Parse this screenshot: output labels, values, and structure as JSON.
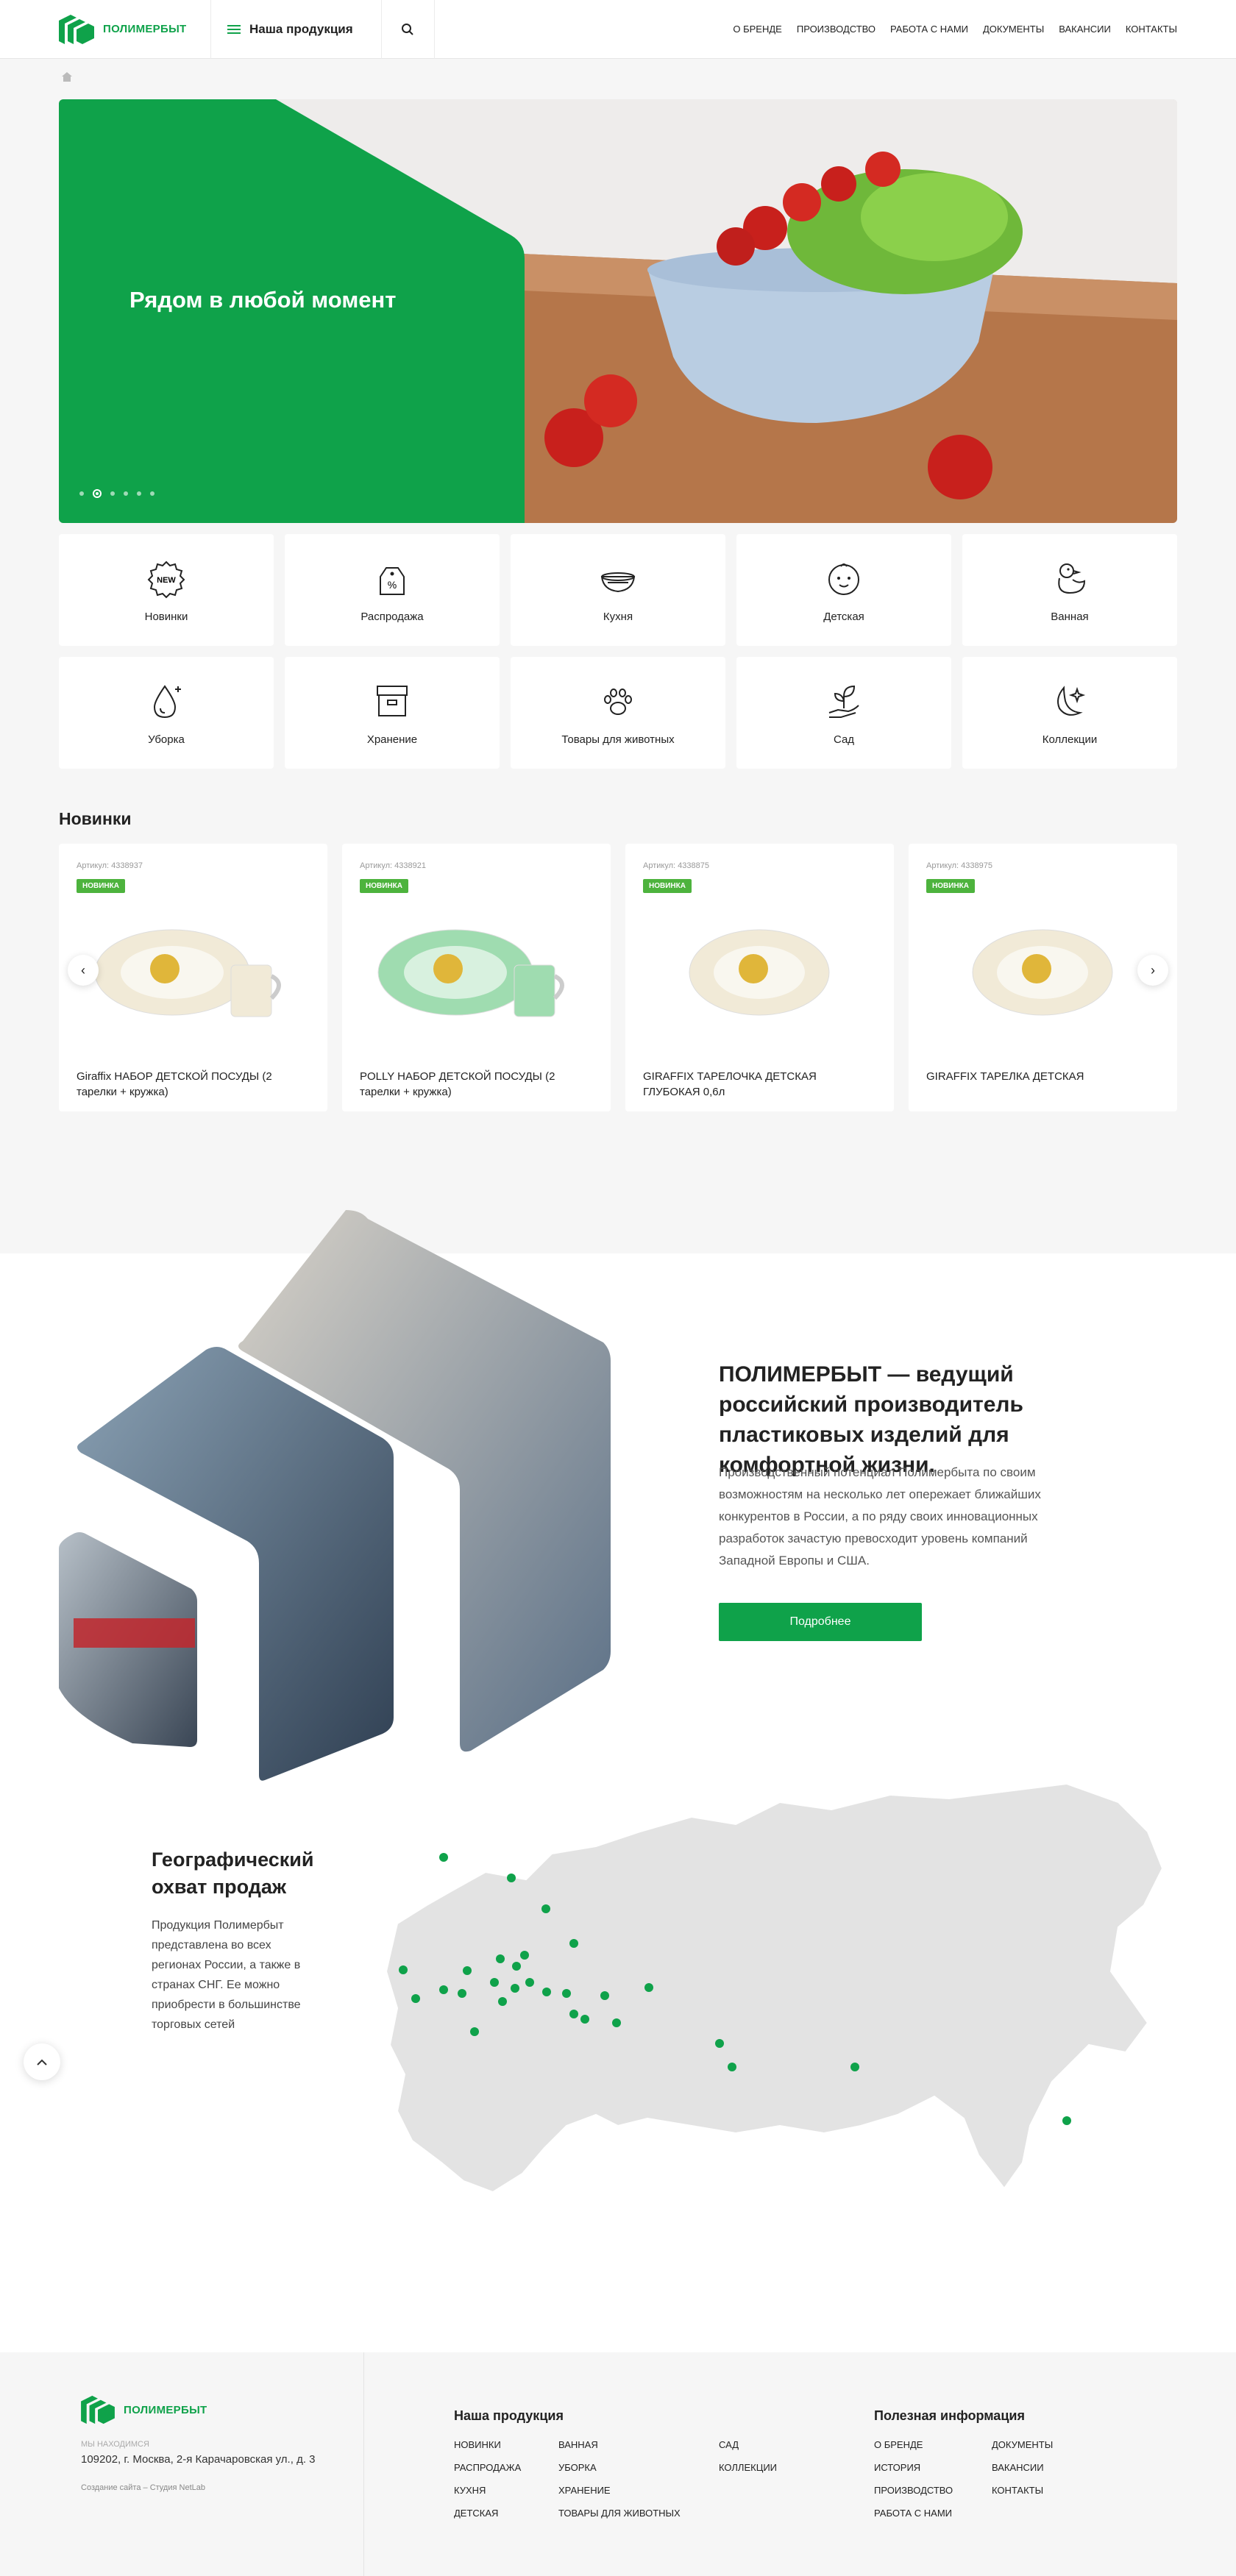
{
  "brand": {
    "name": "ПОЛИМЕРБЫТ",
    "color": "#0fa24a"
  },
  "header": {
    "products_label": "Наша продукция",
    "nav": [
      "О БРЕНДЕ",
      "ПРОИЗВОДСТВО",
      "РАБОТА С НАМИ",
      "ДОКУМЕНТЫ",
      "ВАКАНСИИ",
      "КОНТАКТЫ"
    ]
  },
  "hero": {
    "title": "Рядом в любой момент",
    "slides": 6,
    "active_slide": 2
  },
  "categories": [
    {
      "label": "Новинки",
      "icon": "new-badge-icon"
    },
    {
      "label": "Распродажа",
      "icon": "sale-tag-icon"
    },
    {
      "label": "Кухня",
      "icon": "bowl-icon"
    },
    {
      "label": "Детская",
      "icon": "baby-face-icon"
    },
    {
      "label": "Ванная",
      "icon": "rubber-duck-icon"
    },
    {
      "label": "Уборка",
      "icon": "water-drop-icon"
    },
    {
      "label": "Хранение",
      "icon": "storage-box-icon"
    },
    {
      "label": "Товары для животных",
      "icon": "paw-icon"
    },
    {
      "label": "Сад",
      "icon": "plant-hand-icon"
    },
    {
      "label": "Коллекции",
      "icon": "moon-icon"
    }
  ],
  "novinki": {
    "title": "Новинки",
    "badge": "НОВИНКА",
    "products": [
      {
        "sku": "Артикул: 4338937",
        "name": "Giraffix НАБОР ДЕТСКОЙ ПОСУДЫ (2 тарелки + кружка)",
        "tint": "#f1ead7"
      },
      {
        "sku": "Артикул: 4338921",
        "name": "POLLY НАБОР ДЕТСКОЙ ПОСУДЫ (2 тарелки + кружка)",
        "tint": "#9fdcb0"
      },
      {
        "sku": "Артикул: 4338875",
        "name": "GIRAFFIX ТАРЕЛОЧКА ДЕТСКАЯ ГЛУБОКАЯ 0,6л",
        "tint": "#f1ead7"
      },
      {
        "sku": "Артикул: 4338975",
        "name": "GIRAFFIX ТАРЕЛКА ДЕТСКАЯ",
        "tint": "#f1ead7"
      }
    ]
  },
  "about": {
    "heading": "ПОЛИМЕРБЫТ — ведущий российский производитель пластиковых изделий для комфортной жизни.",
    "text": "Производственный потенциал Полимербыта по своим возможностям на несколько лет опережает ближайших конкурентов в России, а по ряду своих инновационных разработок зачастую превосходит уровень компаний Западной Европы и США.",
    "button": "Подробнее"
  },
  "geo": {
    "heading": "Географический охват продаж",
    "text": "Продукция Полимербыт представлена во всех регионах России, а также в странах СНГ. Ее можно приобрести в большинстве торговых сетей"
  },
  "footer": {
    "we_are": "МЫ НАХОДИМСЯ",
    "address": "109202, г. Москва, 2-я Карачаровская ул., д. 3",
    "credit": "Создание сайта – Студия NetLab",
    "products_title": "Наша продукция",
    "products_links": [
      "НОВИНКИ",
      "ВАННАЯ",
      "САД",
      "РАСПРОДАЖА",
      "УБОРКА",
      "КОЛЛЕКЦИИ",
      "КУХНЯ",
      "ХРАНЕНИЕ",
      "",
      "ДЕТСКАЯ",
      "ТОВАРЫ ДЛЯ ЖИВОТНЫХ",
      ""
    ],
    "info_title": "Полезная информация",
    "info_links": [
      "О БРЕНДЕ",
      "ДОКУМЕНТЫ",
      "ИСТОРИЯ",
      "ВАКАНСИИ",
      "ПРОИЗВОДСТВО",
      "КОНТАКТЫ",
      "РАБОТА С НАМИ",
      ""
    ]
  }
}
